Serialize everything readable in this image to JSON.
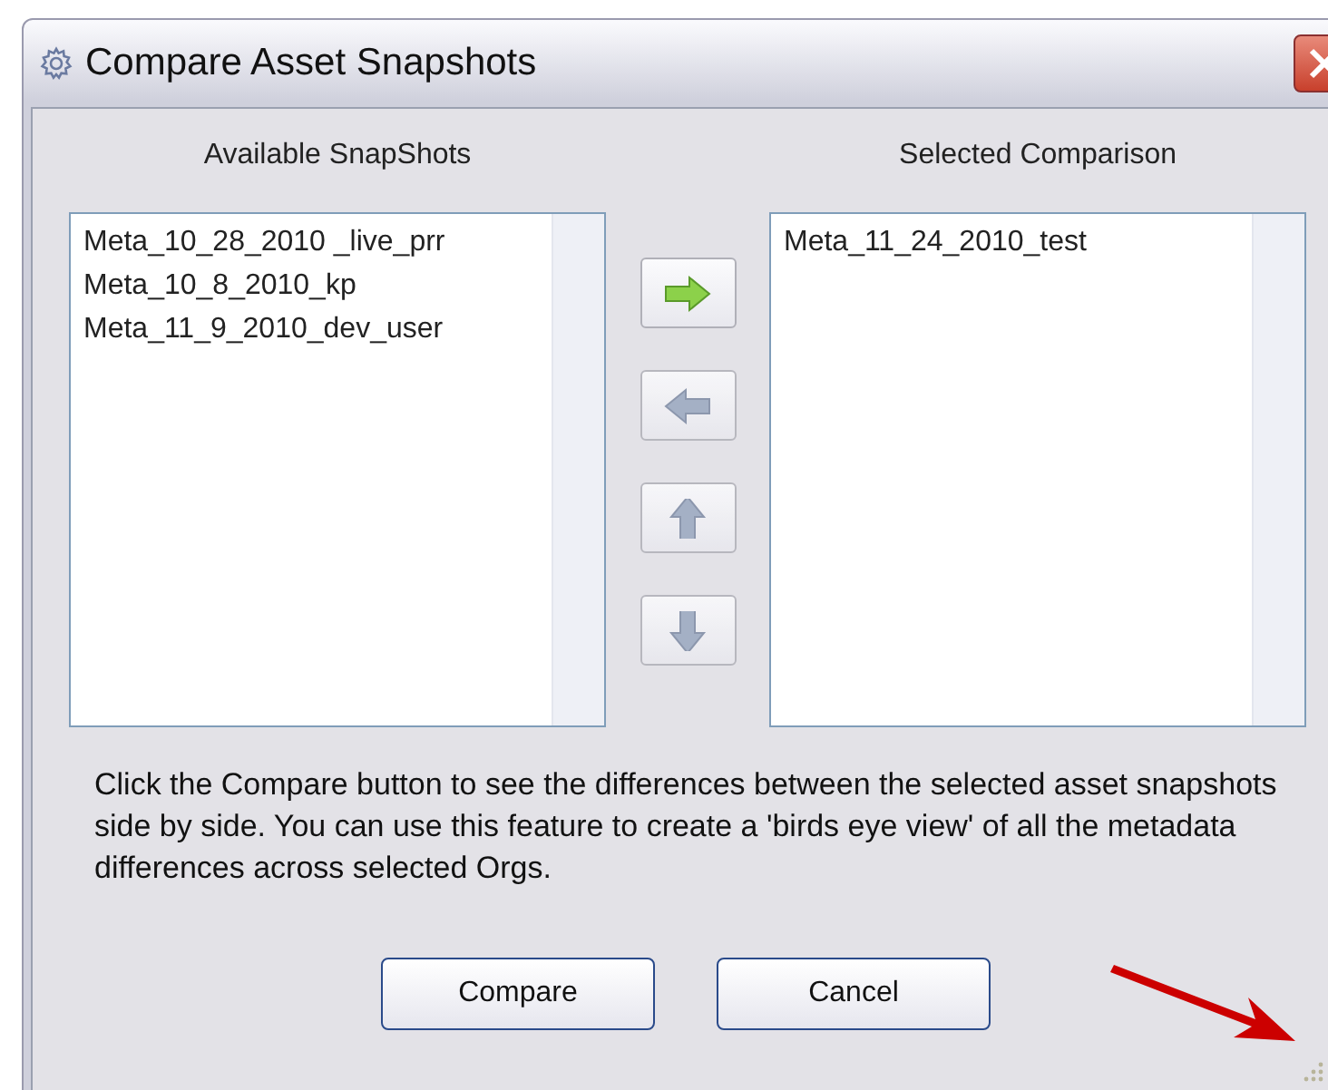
{
  "window": {
    "title": "Compare Asset Snapshots"
  },
  "available": {
    "label": "Available SnapShots",
    "items": [
      {
        "text": "Meta_10_28_2010 _live_prr",
        "selected": false
      },
      {
        "text": "Meta_10_8_2010_kp",
        "selected": false
      },
      {
        "text": "Meta_11_9_2010_dev_user",
        "selected": false
      }
    ]
  },
  "move_buttons": [
    {
      "kind": "right",
      "disabled": false
    },
    {
      "kind": "left",
      "disabled": true
    },
    {
      "kind": "up",
      "disabled": true
    },
    {
      "kind": "down",
      "disabled": true
    }
  ],
  "selected_comparison": {
    "label": "Selected Comparison",
    "items": [
      {
        "text": "Meta_11_24_2010_test",
        "selected": false
      }
    ]
  },
  "description": "Click the Compare button to see the differences between the selected asset snapshots side by side. You can use this feature to create a 'birds eye view' of all the metadata differences across selected Orgs.",
  "buttons": [
    "Compare",
    "Cancel"
  ]
}
